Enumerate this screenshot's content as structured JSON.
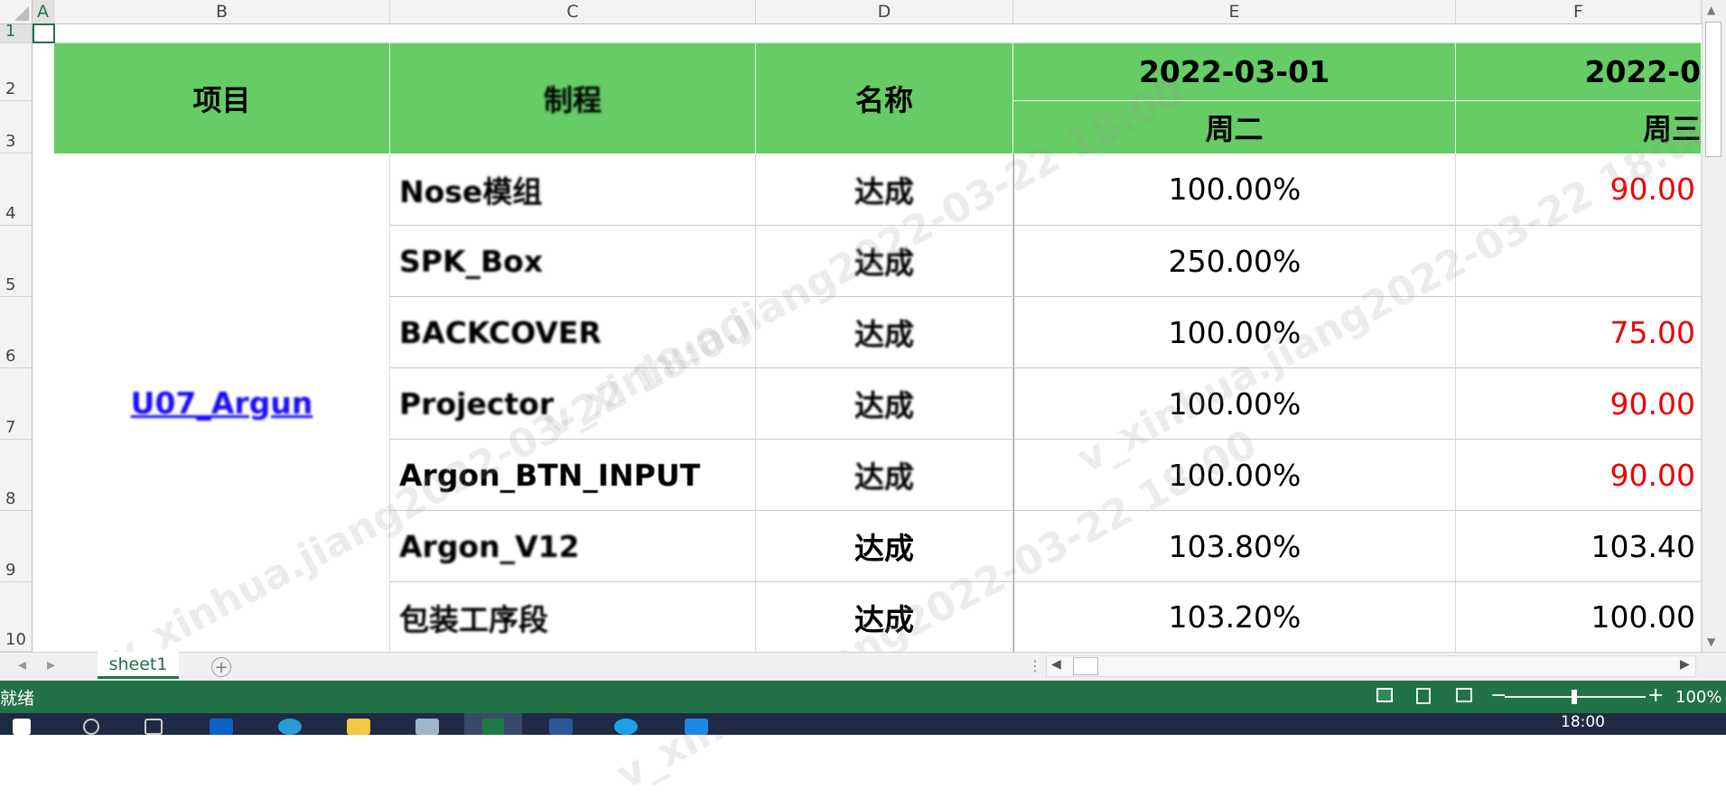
{
  "columns": [
    "A",
    "B",
    "C",
    "D",
    "E",
    "F"
  ],
  "rows": [
    "1",
    "2",
    "3",
    "4",
    "5",
    "6",
    "7",
    "8",
    "9",
    "10"
  ],
  "header": {
    "project": "项目",
    "process": "制程",
    "name": "名称",
    "date1": "2022-03-01",
    "weekday1": "周二",
    "date2": "2022-0",
    "weekday2": "周三"
  },
  "project_link": "U07_Argun",
  "table_rows": [
    {
      "process": "Nose模组",
      "name": "达成",
      "e": "100.00%",
      "f": "90.00",
      "f_red": true
    },
    {
      "process": "SPK_Box",
      "name": "达成",
      "e": "250.00%",
      "f": "",
      "f_red": false
    },
    {
      "process": "BACKCOVER",
      "name": "达成",
      "e": "100.00%",
      "f": "75.00",
      "f_red": true
    },
    {
      "process": "Projector",
      "name": "达成",
      "e": "100.00%",
      "f": "90.00",
      "f_red": true
    },
    {
      "process": "Argon_BTN_INPUT",
      "name": "达成",
      "e": "100.00%",
      "f": "90.00",
      "f_red": true
    },
    {
      "process": "Argon_V12",
      "name": "达成",
      "e": "103.80%",
      "f": "103.40",
      "f_red": false
    },
    {
      "process": "包装工序段",
      "name": "达成",
      "e": "103.20%",
      "f": "100.00",
      "f_red": false
    }
  ],
  "sheet_tab": "sheet1",
  "status": {
    "ready": "就绪",
    "zoom": "100%"
  },
  "clock": "18:00",
  "watermark": "v_xinhua.jiang2022-03-22 18:00",
  "colors": {
    "header_green": "#66cc66",
    "excel_green": "#217346",
    "red": "#e00000",
    "link": "#1a0dff"
  }
}
